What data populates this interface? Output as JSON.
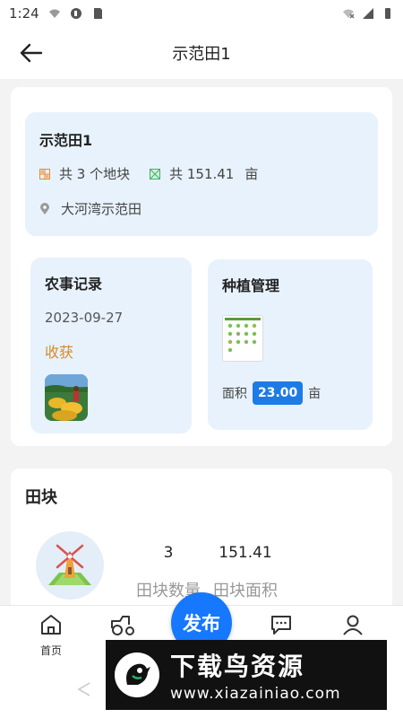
{
  "status_bar": {
    "time": "1:24"
  },
  "header": {
    "title": "示范田1"
  },
  "farm": {
    "name": "示范田1",
    "plots_text": "共 3 个地块",
    "area_text": "共 151.41",
    "area_unit": "亩",
    "location": "大河湾示范田"
  },
  "farm_record": {
    "title": "农事记录",
    "date": "2023-09-27",
    "activity": "收获"
  },
  "planting": {
    "title": "种植管理",
    "area_label": "面积",
    "area_value": "23.00",
    "area_unit": "亩"
  },
  "fields": {
    "title": "田块",
    "count_value": "3",
    "count_label": "田块数量",
    "area_value": "151.41",
    "area_label": "田块面积"
  },
  "bottom_nav": {
    "home_label": "首页",
    "publish_label": "发布"
  },
  "watermark": {
    "title": "下载鸟资源",
    "url": "www.xiazainiao.com"
  },
  "colors": {
    "accent": "#1677ff",
    "card_bg": "#e8f2fc",
    "harvest": "#d68a2a"
  }
}
